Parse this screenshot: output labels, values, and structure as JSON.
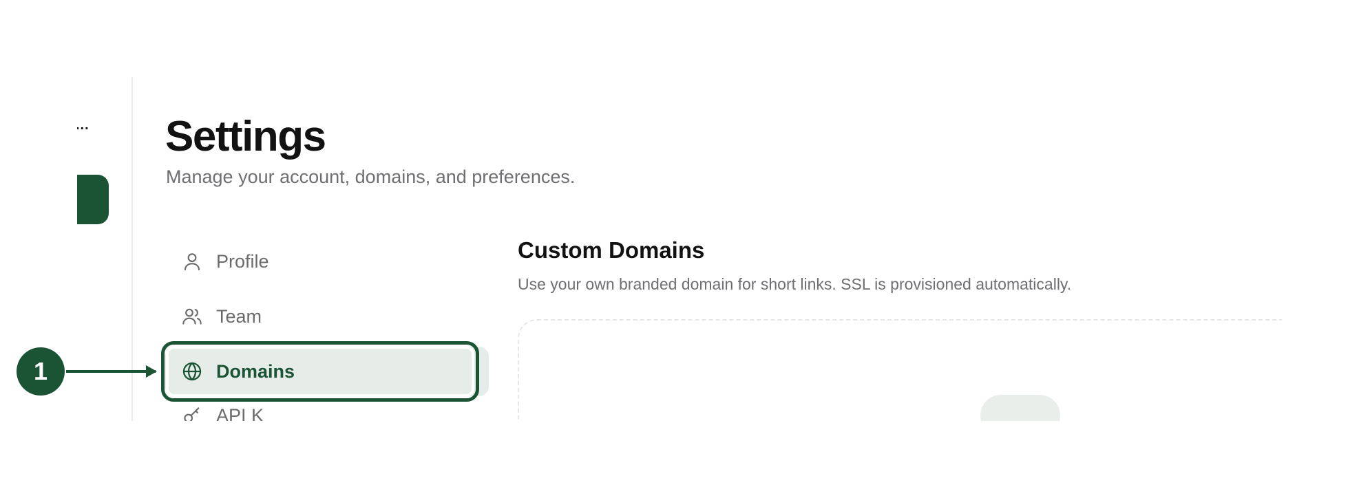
{
  "rail": {
    "more_glyph": "..."
  },
  "header": {
    "title": "Settings",
    "subtitle": "Manage your account, domains, and preferences."
  },
  "settings_nav": {
    "items": [
      {
        "label": "Profile",
        "icon": "user-icon",
        "active": false
      },
      {
        "label": "Team",
        "icon": "users-icon",
        "active": false
      },
      {
        "label": "Domains",
        "icon": "globe-icon",
        "active": true
      },
      {
        "label": "API K",
        "icon": "key-icon",
        "active": false
      }
    ]
  },
  "main": {
    "section_title": "Custom Domains",
    "section_desc": "Use your own branded domain for short links. SSL is provisioned automatically."
  },
  "annotation": {
    "step_number": "1"
  },
  "colors": {
    "brand": "#1a5434",
    "active_bg": "#e6ece8",
    "muted_text": "#6e6e73"
  }
}
